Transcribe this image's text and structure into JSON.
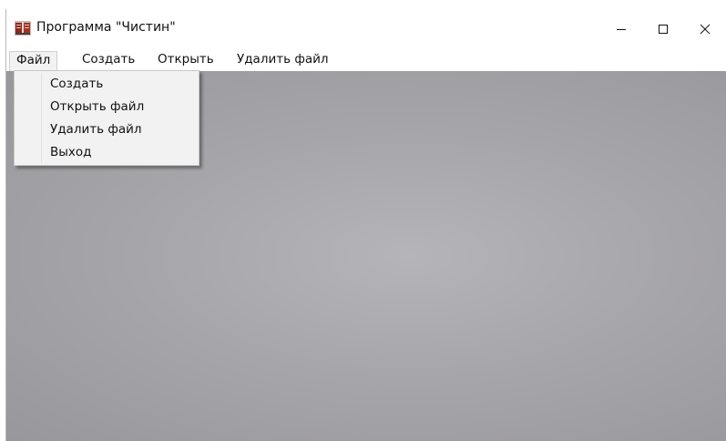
{
  "window": {
    "title": "Программа \"Чистин\"",
    "icon": "app-book-icon",
    "controls": {
      "minimize": "minimize-icon",
      "maximize": "maximize-icon",
      "close": "close-icon"
    }
  },
  "menubar": {
    "items": [
      {
        "label": "Файл",
        "open": true
      },
      {
        "label": "Создать"
      },
      {
        "label": "Открыть"
      },
      {
        "label": "Удалить файл"
      }
    ]
  },
  "file_menu": {
    "items": [
      {
        "label": "Создать"
      },
      {
        "label": "Открыть файл"
      },
      {
        "label": "Удалить файл"
      },
      {
        "label": "Выход"
      }
    ]
  },
  "colors": {
    "client_center": "#b5b4b8",
    "client_edge": "#98979b",
    "menu_background": "#f2f2f2"
  }
}
